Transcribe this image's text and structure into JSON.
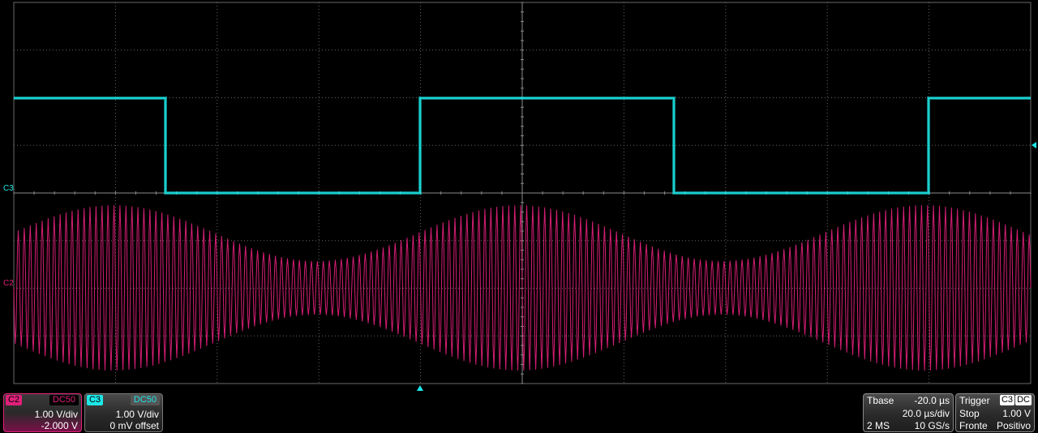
{
  "channels": {
    "c2": {
      "label": "C2",
      "coupling": "DC50",
      "volts_div": "1.00 V/div",
      "offset": "-2.000 V",
      "color": "#e0207a"
    },
    "c3": {
      "label": "C3",
      "coupling": "DC50",
      "volts_div": "1.00 V/div",
      "offset": "0 mV offset",
      "color": "#1ee8e8"
    }
  },
  "markers": {
    "c3": "C3",
    "c2": "C2"
  },
  "timebase": {
    "label": "Tbase",
    "delay": "-20.0 µs",
    "time_div": "20.0 µs/div",
    "samples": "2 MS",
    "rate": "10 GS/s"
  },
  "trigger": {
    "label": "Trigger",
    "source": "C3",
    "coupling": "DC",
    "mode": "Stop",
    "level": "1.00 V",
    "edge_label": "Fronte",
    "slope": "Positivo"
  }
}
